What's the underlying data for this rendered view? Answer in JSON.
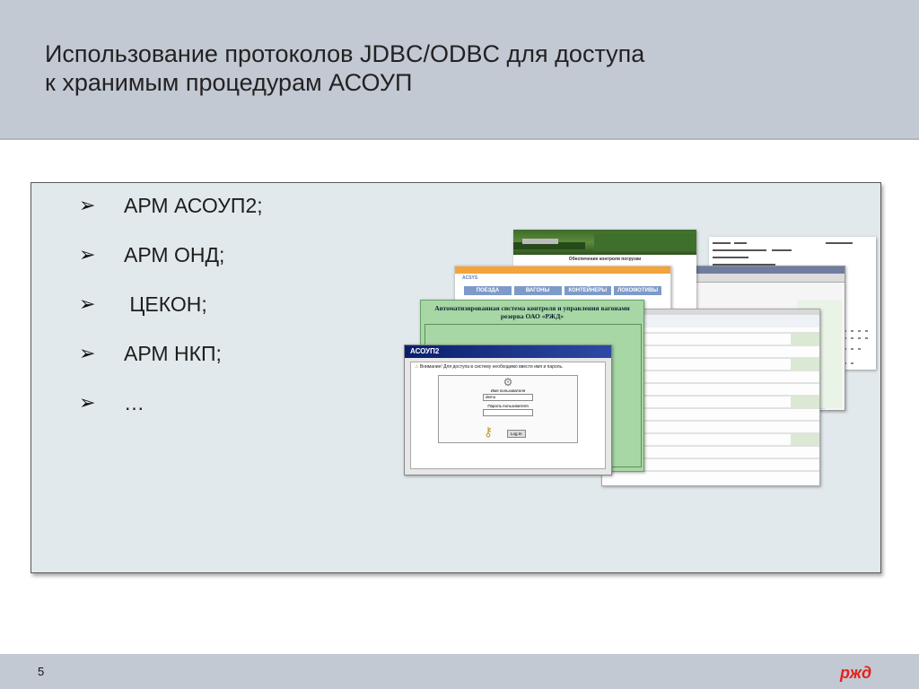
{
  "title": {
    "line1": "Использование протоколов JDBC/ODBC для доступа",
    "line2": "к хранимым процедурам АСОУП"
  },
  "bullets": [
    {
      "mark": "➢",
      "text": "АРМ АСОУП2;"
    },
    {
      "mark": "➢",
      "text": "АРМ ОНД;"
    },
    {
      "mark": "➢",
      "text": " ЦЕКОН;"
    },
    {
      "mark": "➢",
      "text": "АРМ НКП;"
    },
    {
      "mark": "➢",
      "text": "…"
    }
  ],
  "screenshots": {
    "train_banner": "Обеспечение контроля погрузки",
    "nav_tabs": [
      "ПОЕЗДА",
      "ВАГОНЫ",
      "КОНТЕЙНЕРЫ",
      "ЛОКОМОТИВЫ"
    ],
    "green_title": "Автоматизированная система контроля и управления вагонами резерва ОАО «РЖД»",
    "login_app": "АСОУП2",
    "login_warning": "Внимание! Для доступа в систему необходимо ввести имя и пароль.",
    "username_label": "Имя пользователя",
    "username_value": "demo",
    "password_label": "Пароль пользователя",
    "login_button": "Log In"
  },
  "footer": {
    "page_number": "5",
    "logo_text": "РЖД"
  },
  "colors": {
    "header_bg": "#c3c9d3",
    "panel_bg": "#e1e9ec",
    "logo_red": "#e2231a",
    "green_window": "#a7d7a4",
    "nav_blue": "#7d9ac9"
  }
}
